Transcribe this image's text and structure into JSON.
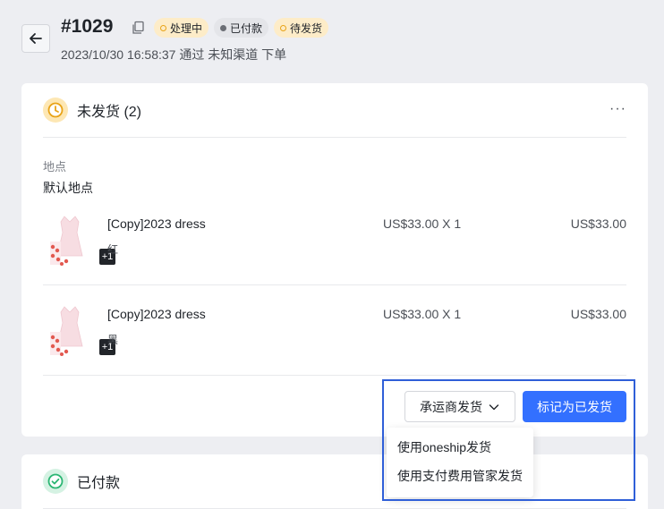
{
  "header": {
    "order_number": "#1029",
    "badges": [
      {
        "label": "处理中",
        "type": "processing"
      },
      {
        "label": "已付款",
        "type": "paid"
      },
      {
        "label": "待发货",
        "type": "pending"
      }
    ],
    "subtitle": "2023/10/30 16:58:37 通过 未知渠道 下单"
  },
  "unfulfilled": {
    "title": "未发货 (2)",
    "more": "···",
    "location_label": "地点",
    "location_value": "默认地点",
    "items": [
      {
        "name": "[Copy]2023 dress",
        "variant": "红",
        "qty": "US$33.00 X 1",
        "total": "US$33.00",
        "extra": "+1"
      },
      {
        "name": "[Copy]2023 dress",
        "variant": "黑",
        "qty": "US$33.00 X 1",
        "total": "US$33.00",
        "extra": "+1"
      }
    ],
    "carrier_button": "承运商发货",
    "mark_button": "标记为已发货",
    "dropdown": [
      "使用oneship发货",
      "使用支付费用管家发货"
    ]
  },
  "paid": {
    "title": "已付款"
  },
  "colors": {
    "primary": "#3370ff",
    "warning": "#e8a317",
    "success": "#2bb673",
    "highlight": "#2f5fd8"
  }
}
